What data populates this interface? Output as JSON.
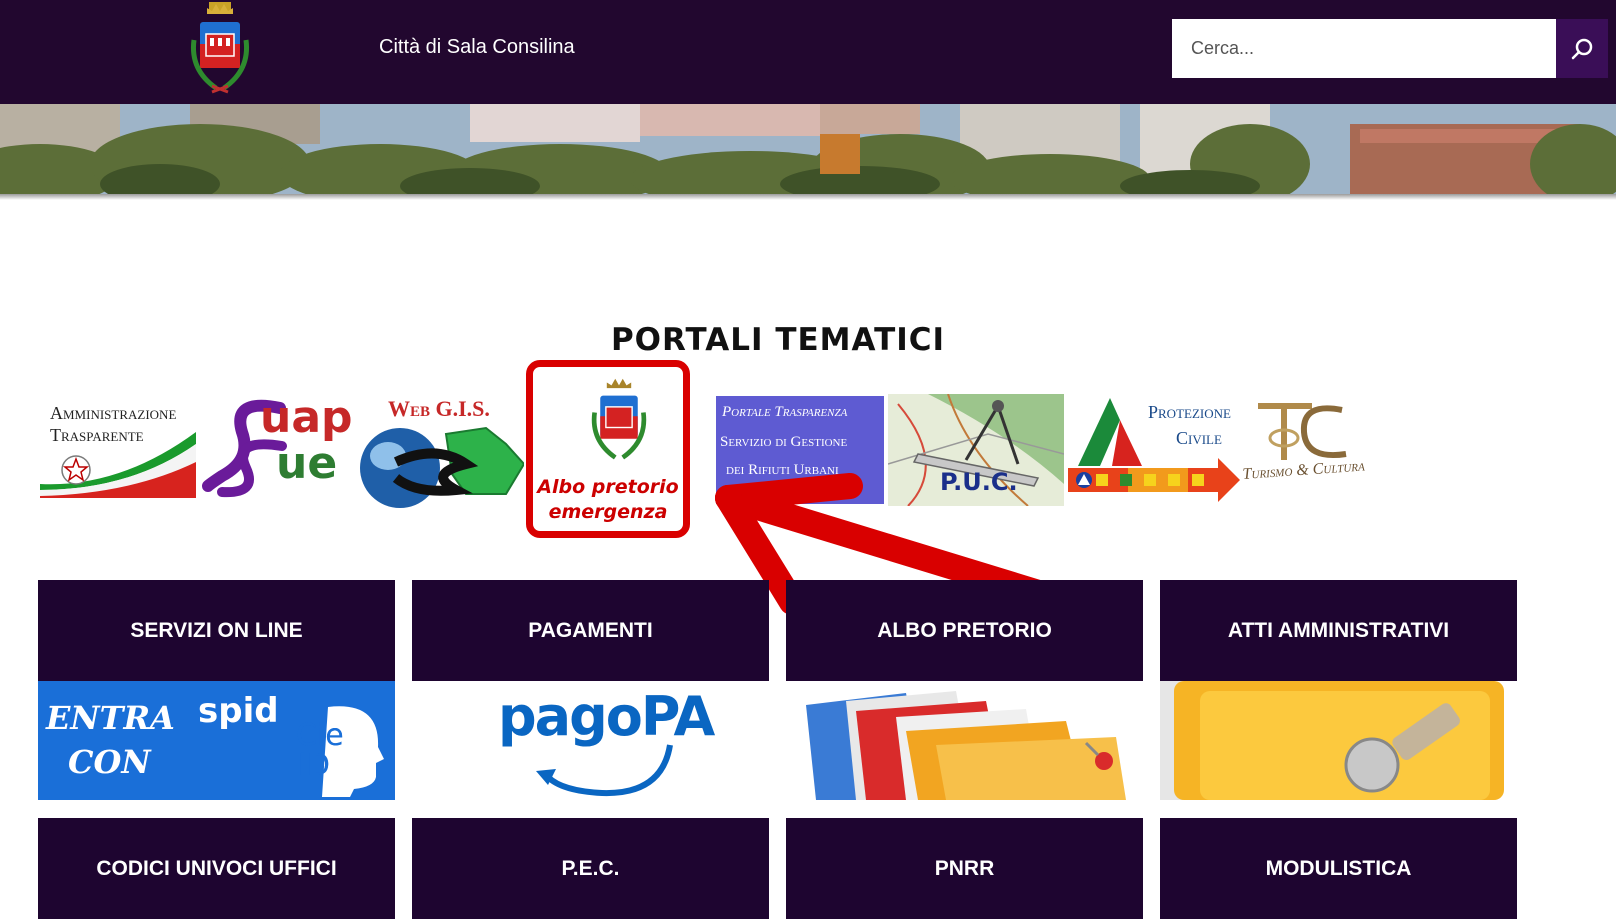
{
  "header": {
    "site_title": "Città di Sala Consilina",
    "search": {
      "placeholder": "Cerca..."
    },
    "icons": [
      "coat-of-arms-logo",
      "search-icon"
    ]
  },
  "portals": {
    "title": "PORTALI TEMATICI",
    "items": [
      {
        "name": "amministrazione-trasparente",
        "line1": "Amministrazione",
        "line2": "Trasparente"
      },
      {
        "name": "suap-sue",
        "line1": "uap",
        "line2": "ue"
      },
      {
        "name": "web-gis",
        "label": "Web G.I.S."
      },
      {
        "name": "albo-pretorio-emergenza",
        "line1": "Albo pretorio",
        "line2": "emergenza"
      },
      {
        "name": "portale-trasparenza",
        "line1": "Portale Trasparenza",
        "line2": "Servizio di Gestione",
        "line3": "dei Rifiuti Urbani"
      },
      {
        "name": "puc",
        "label": "P.U.C."
      },
      {
        "name": "protezione-civile",
        "line1": "Protezione",
        "line2": "Civile"
      },
      {
        "name": "turismo-cultura",
        "label": "Turismo & Cultura"
      }
    ]
  },
  "tiles": [
    {
      "label": "SERVIZI ON LINE",
      "image": {
        "line1": "ENTRA",
        "line2": "CON",
        "spid": "spid",
        "cie1": "Cie",
        "cie2": "ID"
      }
    },
    {
      "label": "PAGAMENTI",
      "image": {
        "text": "pagoPA"
      }
    },
    {
      "label": "ALBO PRETORIO"
    },
    {
      "label": "ATTI AMMINISTRATIVI"
    },
    {
      "label": "CODICI UNIVOCI UFFICI"
    },
    {
      "label": "P.E.C."
    },
    {
      "label": "PNRR"
    },
    {
      "label": "MODULISTICA"
    }
  ],
  "colors": {
    "header_bg": "#22072f",
    "tile_bg": "#1e0530",
    "highlight_red": "#d90000",
    "spid_blue": "#0a6bd0"
  }
}
